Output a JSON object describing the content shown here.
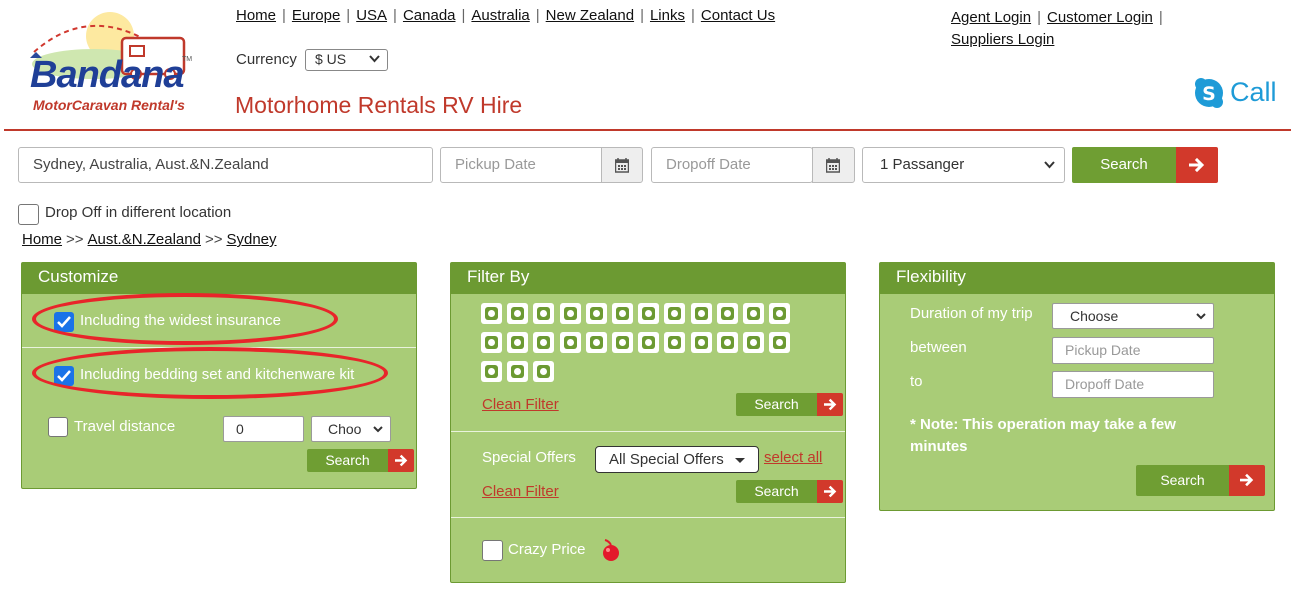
{
  "header": {
    "logo": {
      "brand": "Bandana",
      "tagline": "MotorCaravan Rental's",
      "tm": "TM"
    },
    "nav": [
      "Home",
      "Europe",
      "USA",
      "Canada",
      "Australia",
      "New Zealand",
      "Links",
      "Contact Us"
    ],
    "logins": {
      "agent": "Agent Login",
      "customer": "Customer Login",
      "suppliers": "Suppliers Login"
    },
    "currency_label": "Currency",
    "currency_value": "$ US",
    "title": "Motorhome Rentals RV Hire",
    "call_label": "Call",
    "separator": "|"
  },
  "search": {
    "location_value": "Sydney, Australia, Aust.&N.Zealand",
    "pickup_placeholder": "Pickup Date",
    "dropoff_placeholder": "Dropoff Date",
    "passengers_value": "1 Passanger",
    "search_label": "Search",
    "dropoff_different_label": "Drop Off in different location"
  },
  "breadcrumb": {
    "items": [
      "Home",
      "Aust.&N.Zealand",
      "Sydney"
    ],
    "separator": ">>"
  },
  "customize": {
    "title": "Customize",
    "insurance_label": "Including the widest insurance",
    "insurance_checked": true,
    "bedding_label": "Including bedding set and kitchenware kit",
    "bedding_checked": true,
    "travel_distance_label": "Travel distance",
    "travel_distance_value": "0",
    "distance_unit_value": "Choose",
    "search_label": "Search",
    "highlight_color": "#e8252a"
  },
  "filter": {
    "title": "Filter By",
    "icon_count": 27,
    "clean_filter_label": "Clean Filter",
    "search_label": "Search",
    "special_offers_label": "Special Offers",
    "special_offers_value": "All Special Offers",
    "select_all_label": "select all",
    "crazy_price_label": "Crazy Price"
  },
  "flexibility": {
    "title": "Flexibility",
    "duration_label": "Duration of my trip",
    "duration_value": "Choose",
    "between_label": "between",
    "to_label": "to",
    "pickup_placeholder": "Pickup Date",
    "dropoff_placeholder": "Dropoff Date",
    "note": "* Note: This operation may take a few minutes",
    "search_label": "Search"
  },
  "colors": {
    "panel_bg": "#a9cc77",
    "panel_header": "#6c9a32",
    "button_green": "#6f9e33",
    "button_red": "#d2392b",
    "title_red": "#c0392b",
    "skype_blue": "#1e9bd7"
  }
}
